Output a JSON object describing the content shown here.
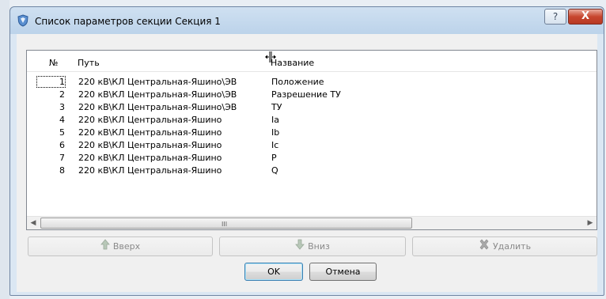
{
  "window": {
    "title": "Список параметров секции Секция 1",
    "help_label": "?",
    "close_label": "X"
  },
  "table": {
    "headers": {
      "no": "№",
      "path": "Путь",
      "name": "Название"
    },
    "rows": [
      {
        "no": "1",
        "path": "220 кВ\\КЛ Центральная-Яшино\\ЭВ",
        "name": "Положение"
      },
      {
        "no": "2",
        "path": "220 кВ\\КЛ Центральная-Яшино\\ЭВ",
        "name": "Разрешение ТУ"
      },
      {
        "no": "3",
        "path": "220 кВ\\КЛ Центральная-Яшино\\ЭВ",
        "name": "ТУ"
      },
      {
        "no": "4",
        "path": "220 кВ\\КЛ Центральная-Яшино",
        "name": "Ia"
      },
      {
        "no": "5",
        "path": "220 кВ\\КЛ Центральная-Яшино",
        "name": "Ib"
      },
      {
        "no": "6",
        "path": "220 кВ\\КЛ Центральная-Яшино",
        "name": "Ic"
      },
      {
        "no": "7",
        "path": "220 кВ\\КЛ Центральная-Яшино",
        "name": "P"
      },
      {
        "no": "8",
        "path": "220 кВ\\КЛ Центральная-Яшино",
        "name": "Q"
      }
    ],
    "scroll_grip": "III"
  },
  "actions": {
    "up_label": "Вверх",
    "down_label": "Вниз",
    "delete_label": "Удалить",
    "ok_label": "OK",
    "cancel_label": "Отмена"
  },
  "icons": {
    "app": "shield-icon",
    "up": "arrow-up-icon",
    "down": "arrow-down-icon",
    "delete": "x-delete-icon",
    "resize": "column-resize-cursor-icon"
  },
  "colors": {
    "title_bar": "#bcd3ea",
    "close_button": "#c7462f",
    "disabled_text": "#8a8a8a",
    "default_button_border": "#3c7fb1"
  }
}
